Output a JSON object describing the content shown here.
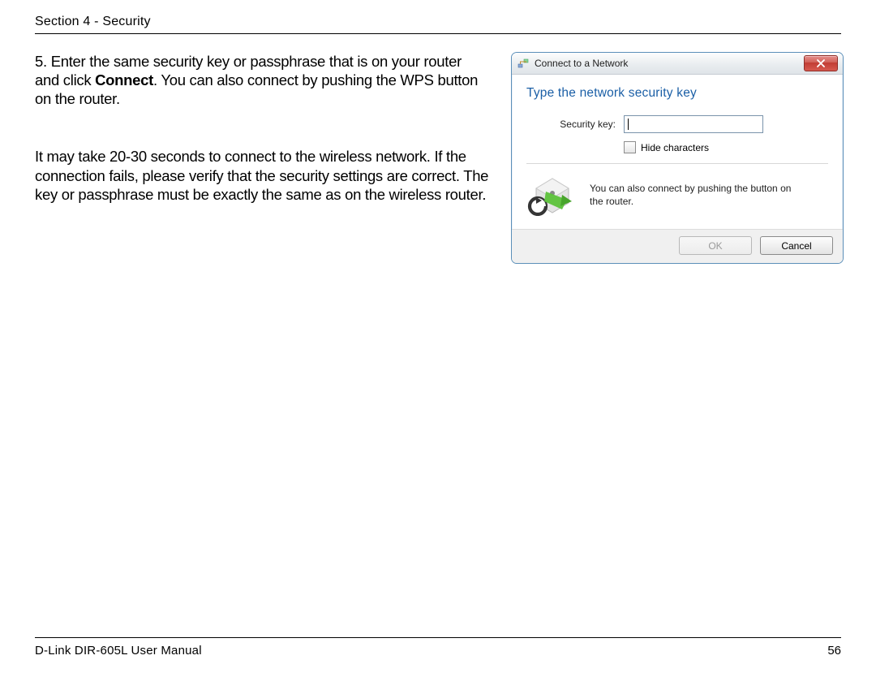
{
  "header": {
    "section_label": "Section 4 - Security"
  },
  "instruction": {
    "number": "5.",
    "pre": "Enter the same security key or passphrase that is on your router and click ",
    "bold": "Connect",
    "post": ". You can also connect by pushing the WPS button on the router."
  },
  "note": "It may take 20-30 seconds to connect to the wireless network. If the connection fails, please verify that the security settings are correct. The key or passphrase must be exactly the same as on the wireless router.",
  "dialog": {
    "title": "Connect to a Network",
    "heading": "Type the network security key",
    "security_key_label": "Security key:",
    "security_key_value": "",
    "hide_chars_label": "Hide characters",
    "wps_hint": "You can also connect by pushing the button on the router.",
    "ok_label": "OK",
    "cancel_label": "Cancel"
  },
  "footer": {
    "manual": "D-Link DIR-605L User Manual",
    "page": "56"
  }
}
